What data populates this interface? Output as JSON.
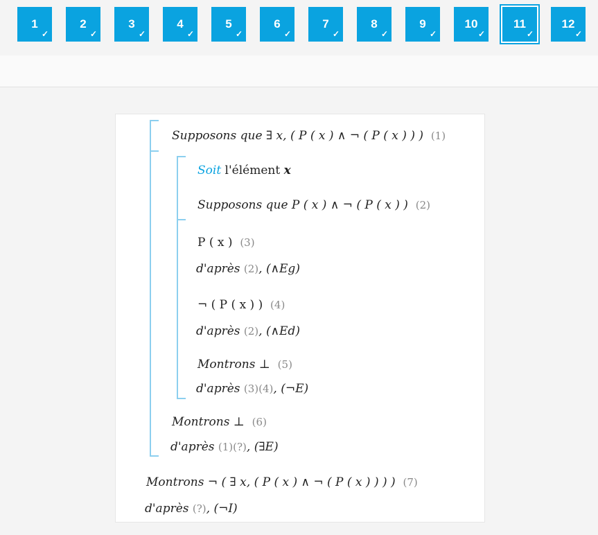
{
  "questions": [
    {
      "label": "1",
      "status": "✓"
    },
    {
      "label": "2",
      "status": "✓"
    },
    {
      "label": "3",
      "status": "✓"
    },
    {
      "label": "4",
      "status": "✓"
    },
    {
      "label": "5",
      "status": "✓"
    },
    {
      "label": "6",
      "status": "✓"
    },
    {
      "label": "7",
      "status": "✓"
    },
    {
      "label": "8",
      "status": "✓"
    },
    {
      "label": "9",
      "status": "✓"
    },
    {
      "label": "10",
      "status": "✓"
    },
    {
      "label": "11",
      "status": "✓",
      "active": true
    },
    {
      "label": "12",
      "status": "✓"
    }
  ],
  "proof": {
    "l1": {
      "text": "Supposons que ∃ x, ( P ( x ) ∧ ¬ ( P ( x ) ) )",
      "num": "(1)"
    },
    "l2": {
      "soit": "Soit",
      "rest": " l'élément ",
      "var": "x"
    },
    "l3": {
      "text": "Supposons que P ( x ) ∧ ¬ ( P ( x ) )",
      "num": "(2)"
    },
    "l4": {
      "text": "P ( x )",
      "num": "(3)"
    },
    "l5": {
      "pre": "d'après ",
      "refs": "(2)",
      "rule": ", (∧Eg)"
    },
    "l6": {
      "text": "¬ ( P ( x ) )",
      "num": "(4)"
    },
    "l7": {
      "pre": "d'après ",
      "refs": "(2)",
      "rule": ", (∧Ed)"
    },
    "l8": {
      "text": "Montrons ⊥",
      "num": "(5)"
    },
    "l9": {
      "pre": "d'après ",
      "refs": "(3)(4)",
      "rule": ", (¬E)"
    },
    "l10": {
      "text": "Montrons ⊥",
      "num": "(6)"
    },
    "l11": {
      "pre": "d'après ",
      "refs": "(1)(?)",
      "rule": ", (∃E)"
    },
    "l12": {
      "text": "Montrons ¬ ( ∃ x, ( P ( x ) ∧ ¬ ( P ( x ) ) ) )",
      "num": "(7)"
    },
    "l13": {
      "pre": "d'après ",
      "refs": "(?)",
      "rule": ", (¬I)"
    }
  }
}
